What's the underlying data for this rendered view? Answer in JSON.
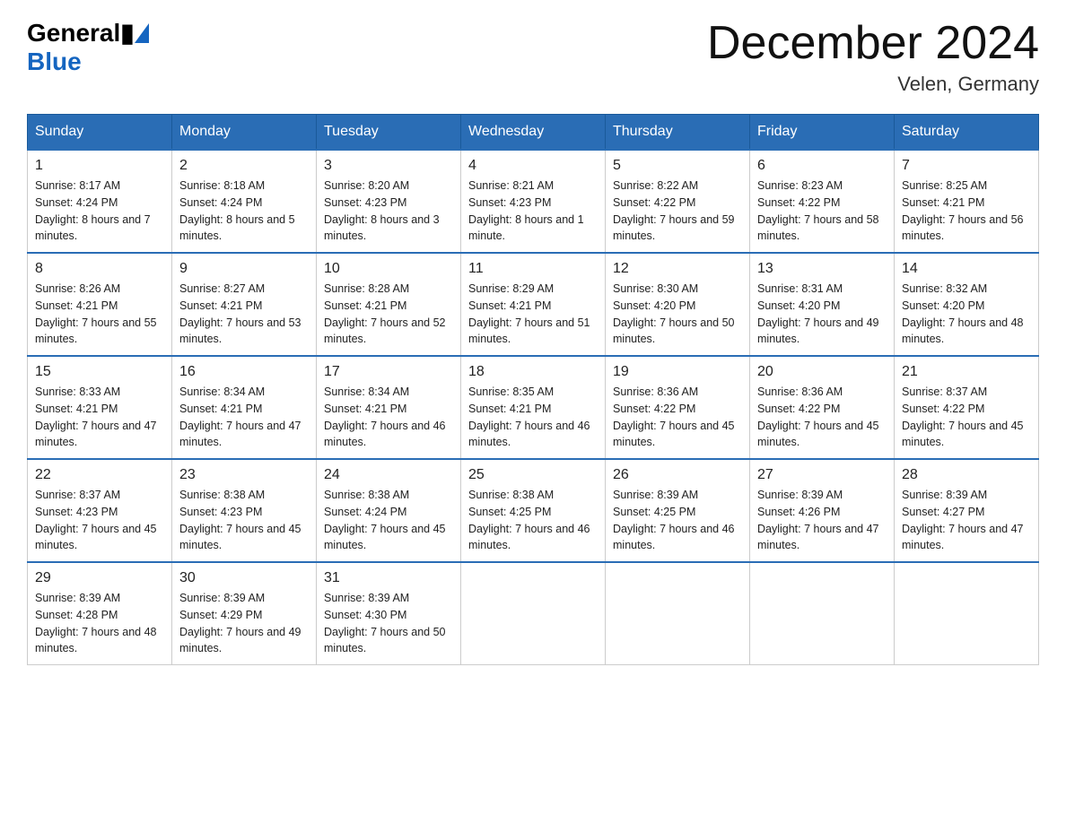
{
  "logo": {
    "general": "General",
    "blue": "Blue"
  },
  "title": {
    "month_year": "December 2024",
    "location": "Velen, Germany"
  },
  "headers": [
    "Sunday",
    "Monday",
    "Tuesday",
    "Wednesday",
    "Thursday",
    "Friday",
    "Saturday"
  ],
  "weeks": [
    [
      {
        "day": "1",
        "sunrise": "8:17 AM",
        "sunset": "4:24 PM",
        "daylight": "8 hours and 7 minutes."
      },
      {
        "day": "2",
        "sunrise": "8:18 AM",
        "sunset": "4:24 PM",
        "daylight": "8 hours and 5 minutes."
      },
      {
        "day": "3",
        "sunrise": "8:20 AM",
        "sunset": "4:23 PM",
        "daylight": "8 hours and 3 minutes."
      },
      {
        "day": "4",
        "sunrise": "8:21 AM",
        "sunset": "4:23 PM",
        "daylight": "8 hours and 1 minute."
      },
      {
        "day": "5",
        "sunrise": "8:22 AM",
        "sunset": "4:22 PM",
        "daylight": "7 hours and 59 minutes."
      },
      {
        "day": "6",
        "sunrise": "8:23 AM",
        "sunset": "4:22 PM",
        "daylight": "7 hours and 58 minutes."
      },
      {
        "day": "7",
        "sunrise": "8:25 AM",
        "sunset": "4:21 PM",
        "daylight": "7 hours and 56 minutes."
      }
    ],
    [
      {
        "day": "8",
        "sunrise": "8:26 AM",
        "sunset": "4:21 PM",
        "daylight": "7 hours and 55 minutes."
      },
      {
        "day": "9",
        "sunrise": "8:27 AM",
        "sunset": "4:21 PM",
        "daylight": "7 hours and 53 minutes."
      },
      {
        "day": "10",
        "sunrise": "8:28 AM",
        "sunset": "4:21 PM",
        "daylight": "7 hours and 52 minutes."
      },
      {
        "day": "11",
        "sunrise": "8:29 AM",
        "sunset": "4:21 PM",
        "daylight": "7 hours and 51 minutes."
      },
      {
        "day": "12",
        "sunrise": "8:30 AM",
        "sunset": "4:20 PM",
        "daylight": "7 hours and 50 minutes."
      },
      {
        "day": "13",
        "sunrise": "8:31 AM",
        "sunset": "4:20 PM",
        "daylight": "7 hours and 49 minutes."
      },
      {
        "day": "14",
        "sunrise": "8:32 AM",
        "sunset": "4:20 PM",
        "daylight": "7 hours and 48 minutes."
      }
    ],
    [
      {
        "day": "15",
        "sunrise": "8:33 AM",
        "sunset": "4:21 PM",
        "daylight": "7 hours and 47 minutes."
      },
      {
        "day": "16",
        "sunrise": "8:34 AM",
        "sunset": "4:21 PM",
        "daylight": "7 hours and 47 minutes."
      },
      {
        "day": "17",
        "sunrise": "8:34 AM",
        "sunset": "4:21 PM",
        "daylight": "7 hours and 46 minutes."
      },
      {
        "day": "18",
        "sunrise": "8:35 AM",
        "sunset": "4:21 PM",
        "daylight": "7 hours and 46 minutes."
      },
      {
        "day": "19",
        "sunrise": "8:36 AM",
        "sunset": "4:22 PM",
        "daylight": "7 hours and 45 minutes."
      },
      {
        "day": "20",
        "sunrise": "8:36 AM",
        "sunset": "4:22 PM",
        "daylight": "7 hours and 45 minutes."
      },
      {
        "day": "21",
        "sunrise": "8:37 AM",
        "sunset": "4:22 PM",
        "daylight": "7 hours and 45 minutes."
      }
    ],
    [
      {
        "day": "22",
        "sunrise": "8:37 AM",
        "sunset": "4:23 PM",
        "daylight": "7 hours and 45 minutes."
      },
      {
        "day": "23",
        "sunrise": "8:38 AM",
        "sunset": "4:23 PM",
        "daylight": "7 hours and 45 minutes."
      },
      {
        "day": "24",
        "sunrise": "8:38 AM",
        "sunset": "4:24 PM",
        "daylight": "7 hours and 45 minutes."
      },
      {
        "day": "25",
        "sunrise": "8:38 AM",
        "sunset": "4:25 PM",
        "daylight": "7 hours and 46 minutes."
      },
      {
        "day": "26",
        "sunrise": "8:39 AM",
        "sunset": "4:25 PM",
        "daylight": "7 hours and 46 minutes."
      },
      {
        "day": "27",
        "sunrise": "8:39 AM",
        "sunset": "4:26 PM",
        "daylight": "7 hours and 47 minutes."
      },
      {
        "day": "28",
        "sunrise": "8:39 AM",
        "sunset": "4:27 PM",
        "daylight": "7 hours and 47 minutes."
      }
    ],
    [
      {
        "day": "29",
        "sunrise": "8:39 AM",
        "sunset": "4:28 PM",
        "daylight": "7 hours and 48 minutes."
      },
      {
        "day": "30",
        "sunrise": "8:39 AM",
        "sunset": "4:29 PM",
        "daylight": "7 hours and 49 minutes."
      },
      {
        "day": "31",
        "sunrise": "8:39 AM",
        "sunset": "4:30 PM",
        "daylight": "7 hours and 50 minutes."
      },
      null,
      null,
      null,
      null
    ]
  ],
  "labels": {
    "sunrise": "Sunrise:",
    "sunset": "Sunset:",
    "daylight": "Daylight:"
  }
}
